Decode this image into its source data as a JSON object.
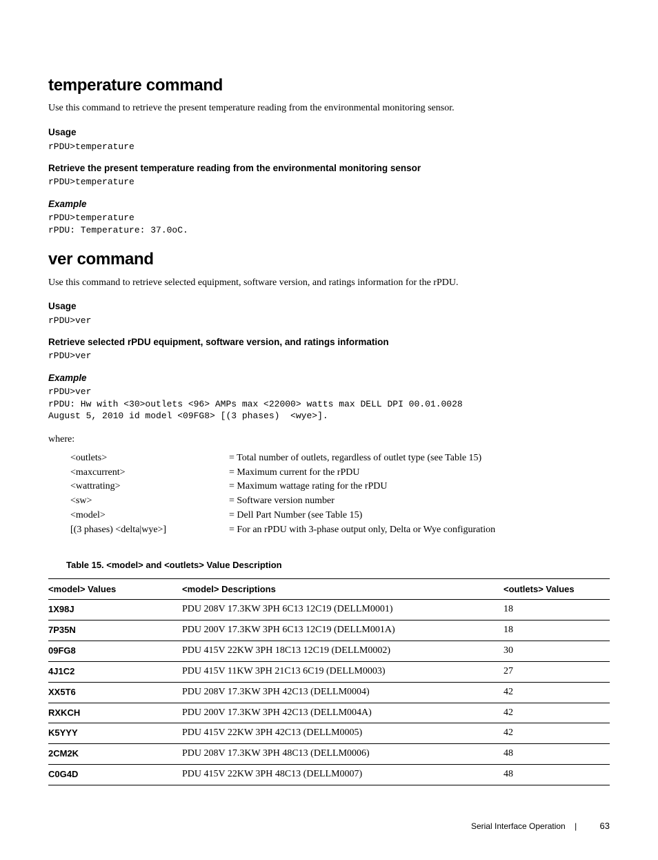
{
  "sec1": {
    "title": "temperature command",
    "desc": "Use this command to retrieve the present temperature reading from the environmental monitoring sensor.",
    "usage_h": "Usage",
    "usage_cmd": "rPDU>temperature",
    "retrieve_h": "Retrieve the present temperature reading from the environmental monitoring sensor",
    "retrieve_cmd": "rPDU>temperature",
    "example_h": "Example",
    "example_body": "rPDU>temperature\nrPDU: Temperature: 37.0oC."
  },
  "sec2": {
    "title": "ver command",
    "desc": "Use this command to retrieve selected equipment, software version, and ratings information for the rPDU.",
    "usage_h": "Usage",
    "usage_cmd": "rPDU>ver",
    "retrieve_h": "Retrieve selected rPDU equipment, software version, and ratings information",
    "retrieve_cmd": "rPDU>ver",
    "example_h": "Example",
    "example_body": "rPDU>ver\nrPDU: Hw with <30>outlets <96> AMPs max <22000> watts max DELL DPI 00.01.0028 \nAugust 5, 2010 id model <09FG8> [(3 phases)  <wye>].",
    "where_label": "where:",
    "where": [
      {
        "t": "<outlets>",
        "d": "= Total number of outlets, regardless of outlet type (see Table 15)"
      },
      {
        "t": "<maxcurrent>",
        "d": "= Maximum current for the rPDU"
      },
      {
        "t": "<wattrating>",
        "d": "= Maximum wattage rating for the rPDU"
      },
      {
        "t": "<sw>",
        "d": "= Software version number"
      },
      {
        "t": "<model>",
        "d": "= Dell Part Number (see Table 15)"
      },
      {
        "t": "[(3 phases) <delta|wye>]",
        "d": "= For an rPDU with 3-phase output only, Delta or Wye configuration"
      }
    ]
  },
  "table": {
    "caption": "Table 15. <model> and <outlets> Value Description",
    "h1": "<model> Values",
    "h2": "<model> Descriptions",
    "h3": "<outlets> Values",
    "rows": [
      {
        "m": "1X98J",
        "d": "PDU 208V 17.3KW 3PH 6C13 12C19 (DELLM0001)",
        "o": "18"
      },
      {
        "m": "7P35N",
        "d": "PDU 200V 17.3KW 3PH 6C13 12C19 (DELLM001A)",
        "o": "18"
      },
      {
        "m": "09FG8",
        "d": "PDU 415V 22KW 3PH 18C13 12C19 (DELLM0002)",
        "o": "30"
      },
      {
        "m": "4J1C2",
        "d": "PDU 415V 11KW 3PH 21C13 6C19 (DELLM0003)",
        "o": "27"
      },
      {
        "m": "XX5T6",
        "d": "PDU 208V 17.3KW 3PH 42C13 (DELLM0004)",
        "o": "42"
      },
      {
        "m": "RXKCH",
        "d": "PDU 200V 17.3KW 3PH 42C13 (DELLM004A)",
        "o": "42"
      },
      {
        "m": "K5YYY",
        "d": "PDU 415V 22KW 3PH 42C13 (DELLM0005)",
        "o": "42"
      },
      {
        "m": "2CM2K",
        "d": "PDU 208V 17.3KW 3PH 48C13  (DELLM0006)",
        "o": "48"
      },
      {
        "m": "C0G4D",
        "d": "PDU 415V 22KW 3PH 48C13  (DELLM0007)",
        "o": "48"
      }
    ]
  },
  "footer": {
    "section": "Serial Interface Operation",
    "page": "63"
  }
}
